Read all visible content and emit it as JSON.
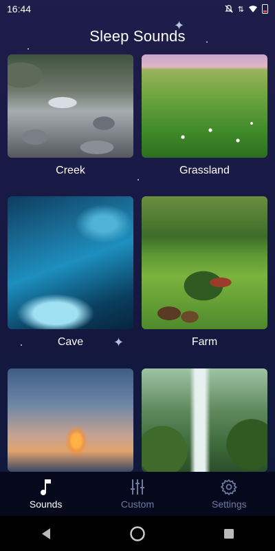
{
  "status": {
    "time": "16:44"
  },
  "header": {
    "title": "Sleep Sounds"
  },
  "sounds": [
    {
      "label": "Creek",
      "scene": "creek"
    },
    {
      "label": "Grassland",
      "scene": "grass"
    },
    {
      "label": "Cave",
      "scene": "cave"
    },
    {
      "label": "Farm",
      "scene": "farm"
    },
    {
      "label": "",
      "scene": "fire"
    },
    {
      "label": "",
      "scene": "waterfall"
    }
  ],
  "bottom_nav": [
    {
      "label": "Sounds",
      "icon": "music-note-icon",
      "active": true
    },
    {
      "label": "Custom",
      "icon": "sliders-icon",
      "active": false
    },
    {
      "label": "Settings",
      "icon": "gear-icon",
      "active": false
    }
  ],
  "system_nav": {
    "back_icon": "back-icon",
    "home_icon": "home-icon",
    "recents_icon": "recents-icon"
  },
  "colors": {
    "active_tab": "#ffffff",
    "inactive_tab": "#6f7aa3",
    "background_top": "#1f1d4a",
    "background_bottom": "#0e1a3b"
  }
}
